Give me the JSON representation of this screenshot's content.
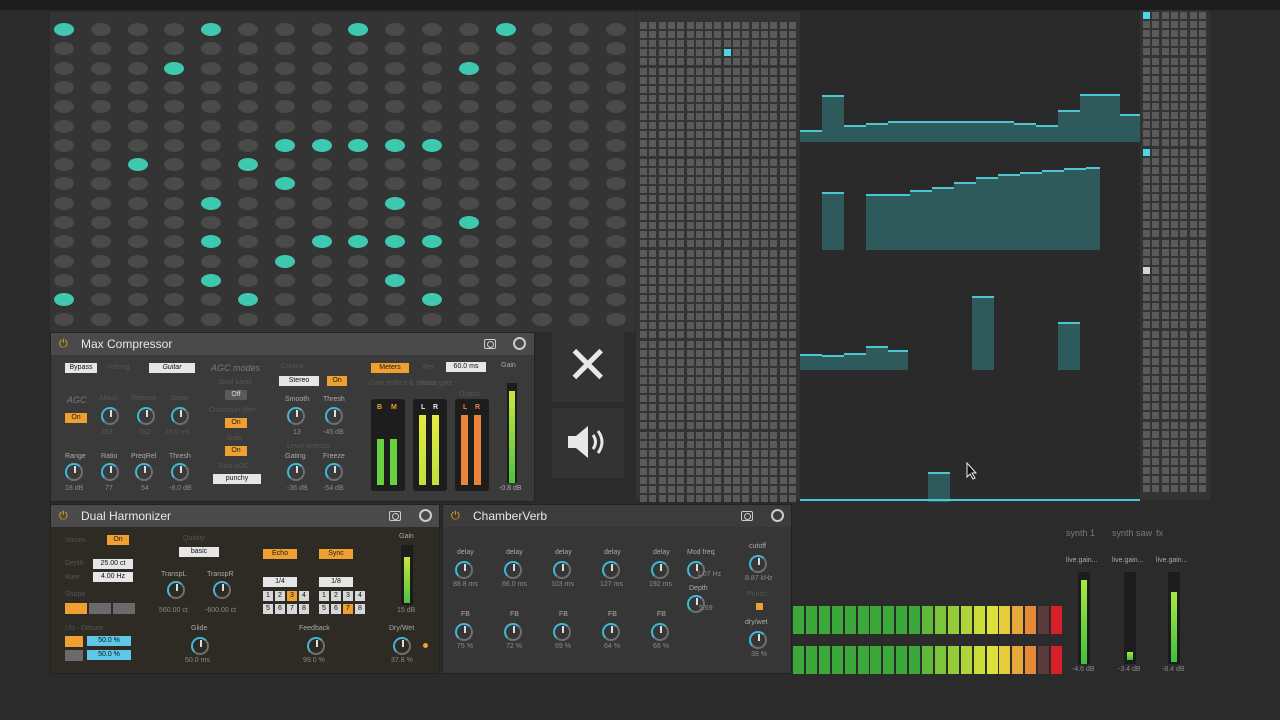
{
  "grid": {
    "cols": 16,
    "rows": 16,
    "on": [
      [
        0,
        0
      ],
      [
        4,
        0
      ],
      [
        8,
        0
      ],
      [
        12,
        0
      ],
      [
        3,
        2
      ],
      [
        11,
        2
      ],
      [
        6,
        6
      ],
      [
        7,
        6
      ],
      [
        8,
        6
      ],
      [
        9,
        6
      ],
      [
        10,
        6
      ],
      [
        2,
        7
      ],
      [
        5,
        7
      ],
      [
        6,
        8
      ],
      [
        4,
        9
      ],
      [
        9,
        9
      ],
      [
        11,
        10
      ],
      [
        4,
        11
      ],
      [
        7,
        11
      ],
      [
        8,
        11
      ],
      [
        9,
        11
      ],
      [
        10,
        11
      ],
      [
        6,
        12
      ],
      [
        4,
        13
      ],
      [
        9,
        13
      ],
      [
        0,
        14
      ],
      [
        5,
        14
      ],
      [
        10,
        14
      ]
    ]
  },
  "max_compressor": {
    "title": "Max Compressor",
    "bypass": "Bypass",
    "voicing_label": "Voicing",
    "voicing_value": "Guitar",
    "agc_modes": "AGC modes",
    "agc_label": "AGC",
    "agc_on": "On",
    "attack_label": "Attack",
    "attack_val": "253",
    "release_label": "Release",
    "release_val": "592",
    "delay_label": "Delay",
    "delay_val": "25.0 ms",
    "dual_band": "Dual band",
    "dual_band_val": "Off",
    "crossover": "Crossover filter",
    "crossover_val": "On",
    "gate_label": "Gate",
    "gate_val": "On",
    "fast_agc": "Fast AGC",
    "fast_agc_val": "punchy",
    "range_label": "Range",
    "range_val": "18 dB",
    "ratio_label": "Ratio",
    "ratio_val": "77",
    "preqrel_label": "PreqRel",
    "preqrel_val": "54",
    "thresh_label": "Thresh",
    "thresh_val": "-8.0 dB",
    "control_label": "Control",
    "stereo_val": "Stereo",
    "stereo_on": "On",
    "smooth_label": "Smooth",
    "smooth_val": "13",
    "thresh2_label": "Thresh",
    "thresh2_val": "-45 dB",
    "level_detector": "Level detector",
    "gating_label": "Gating",
    "gating_val": "-36 dB",
    "freeze_label": "Freeze",
    "freeze_val": "-54 dB",
    "meters": "Meters",
    "ref_label": "Ref",
    "ref_val": "60.0 ms",
    "gain_label": "Gain",
    "gain_val": "-0.8 dB",
    "gain_reduce_label": "Gain reduce & mixout",
    "noise_gate_label": "Noise gate",
    "output_label": "Output",
    "m_B": "B",
    "m_M": "M",
    "m_L": "L",
    "m_R": "R",
    "m_L2": "L",
    "m_R2": "R"
  },
  "dual_harmonizer": {
    "title": "Dual Harmonizer",
    "voices_label": "Voices",
    "voices_on": "On",
    "quality_label": "Quality",
    "quality_val": "basic",
    "depth_label": "Depth",
    "depth_val": "25.00 ct",
    "rate_label": "Rate",
    "rate_val": "4.00 Hz",
    "shape_label": "Shape",
    "transpL_label": "TranspL",
    "transpL_val": "560.00 ct",
    "transpR_label": "TranspR",
    "transpR_val": "-600.00 ct",
    "glide_label": "Glide",
    "glide_val": "50.0 ms",
    "lfo_label": "Lfo - Detune",
    "lfo1_val": "50.0 %",
    "lfo2_val": "50.0 %",
    "echo": "Echo",
    "sync": "Sync",
    "div1": "1/4",
    "div2": "1/8",
    "feedback_label": "Feedback",
    "feedback_val": "99.0 %",
    "gain_label": "Gain",
    "gain_val": "15 dB",
    "drywet_label": "Dry/Wet",
    "drywet_val": "37.8 %",
    "steps_row1": [
      "1",
      "2",
      "3",
      "4"
    ],
    "steps_row2": [
      "5",
      "6",
      "7",
      "8"
    ]
  },
  "chamberverb": {
    "title": "ChamberVerb",
    "delays": [
      {
        "label": "delay",
        "val": "88.8 ms",
        "fb": "FB",
        "fbv": "75 %"
      },
      {
        "label": "delay",
        "val": "66.0 ms",
        "fb": "FB",
        "fbv": "72 %"
      },
      {
        "label": "delay",
        "val": "103 ms",
        "fb": "FB",
        "fbv": "69 %"
      },
      {
        "label": "delay",
        "val": "127 ms",
        "fb": "FB",
        "fbv": "64 %"
      },
      {
        "label": "delay",
        "val": "192 ms",
        "fb": "FB",
        "fbv": "66 %"
      }
    ],
    "modfreq_label": "Mod freq",
    "modfreq_val": "1.07 Hz",
    "depth_label": "Depth",
    "depth_val": "5.69",
    "cutoff_label": "cutoff",
    "cutoff_val": "8.87 kHz",
    "punch_label": "Punch",
    "drywet_label": "dry/wet",
    "drywet_val": "38 %"
  },
  "mixer": {
    "channels": [
      {
        "name": "synth 1",
        "gain_label": "live.gain...",
        "db": "-4.6 dB"
      },
      {
        "name": "synth saw",
        "gain_label": "live.gain...",
        "db": "-3.4 dB"
      },
      {
        "name": "fx",
        "gain_label": "live.gain...",
        "db": "-8.4 dB"
      }
    ]
  },
  "icons": {
    "close": "close-x-icon",
    "speaker": "speaker-volume-icon"
  },
  "colors": {
    "accent_teal": "#3fc8b0",
    "accent_orange": "#f0a030",
    "cyan_line": "#4fc6d4"
  }
}
